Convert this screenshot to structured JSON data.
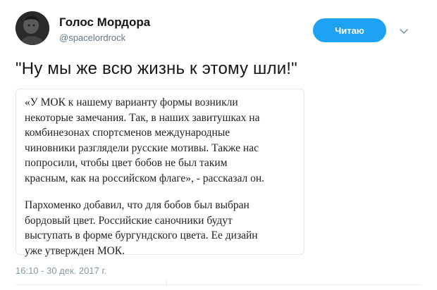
{
  "author": {
    "name": "Голос Мордора",
    "handle": "@spacelordrock"
  },
  "follow_button": {
    "label": "Читаю",
    "color": "#1da1f2"
  },
  "icons": {
    "menu": "chevron-down-icon"
  },
  "tweet": {
    "text": "\"Ну мы же всю жизнь к этому шли!\"",
    "quote_paragraphs": [
      {
        "lines": [
          "«У МОК к нашему варианту формы возникли",
          "некоторые замечания. Так, в наших завитушках на",
          "комбинезонах спортсменов международные",
          "чиновники разглядели русские мотивы. Также нас",
          "попросили, чтобы цвет бобов не был таким",
          "красным, как на российском флаге», - рассказал он."
        ]
      },
      {
        "lines": [
          "Пархоменко добавил, что для бобов был выбран",
          "бордовый цвет. Российские саночники будут",
          "выступать в форме бургундского цвета. Ее дизайн",
          "уже утвержден МОК."
        ]
      }
    ],
    "timestamp": "16:10 - 30 дек. 2017 г."
  }
}
